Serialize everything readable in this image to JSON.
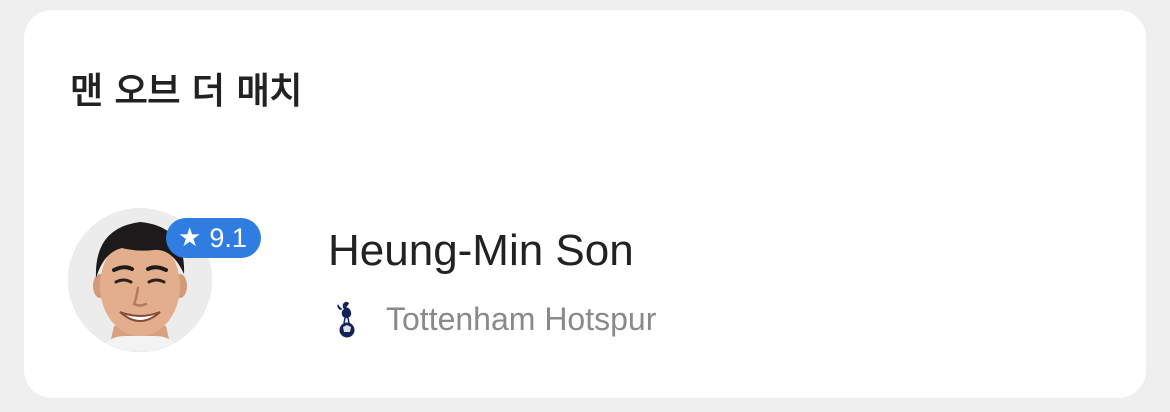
{
  "card": {
    "title": "맨 오브 더 매치"
  },
  "player": {
    "name": "Heung-Min Son",
    "team": "Tottenham Hotspur",
    "rating": "9.1",
    "rating_icon": "star-icon",
    "avatar_icon": "player-avatar",
    "team_icon": "tottenham-crest-icon"
  },
  "colors": {
    "badge": "#2f7de1",
    "title": "#222222",
    "subtitle": "#8a8a8a",
    "card": "#ffffff",
    "background": "#efefef"
  }
}
